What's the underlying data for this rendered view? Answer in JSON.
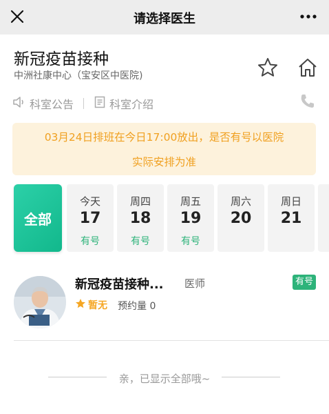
{
  "nav": {
    "title": "请选择医生"
  },
  "clinic": {
    "name": "新冠疫苗接种",
    "hospital": "中洲社康中心（宝安区中医院)"
  },
  "links": {
    "announcement": "科室公告",
    "intro": "科室介绍"
  },
  "notice": {
    "line1": "03月24日排班在今日17:00放出，是否有号以医院",
    "line2": "实际安排为准"
  },
  "schedule": {
    "all_label": "全部",
    "days": [
      {
        "label": "今天",
        "date": "17",
        "status": "有号"
      },
      {
        "label": "周四",
        "date": "18",
        "status": "有号"
      },
      {
        "label": "周五",
        "date": "19",
        "status": "有号"
      },
      {
        "label": "周六",
        "date": "20",
        "status": ""
      },
      {
        "label": "周日",
        "date": "21",
        "status": ""
      }
    ]
  },
  "doctor": {
    "name": "新冠疫苗接种...",
    "title": "医师",
    "badge": "有号",
    "rating": "暂无",
    "booking_count": "预约量 0"
  },
  "footer": {
    "text": "亲，已显示全部哦~"
  },
  "colors": {
    "accent": "#2db37a",
    "notice_text": "#f0a020",
    "notice_bg": "#fdf2dc",
    "star": "#f5a623"
  },
  "icons": [
    "close-icon",
    "more-icon",
    "star-icon",
    "home-icon",
    "speaker-icon",
    "document-icon",
    "phone-icon",
    "rating-star-icon"
  ]
}
